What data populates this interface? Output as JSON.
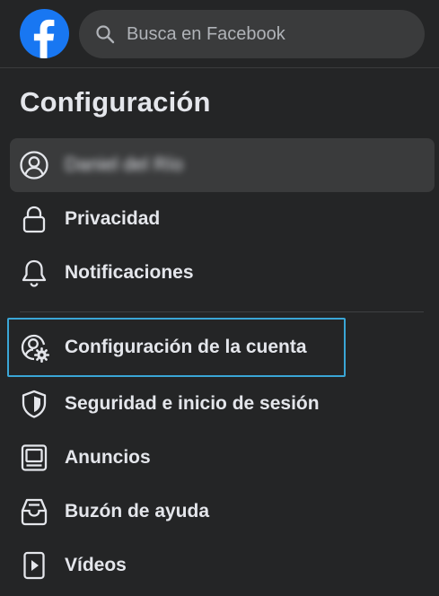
{
  "search": {
    "placeholder": "Busca en Facebook"
  },
  "page_title": "Configuración",
  "menu": {
    "profile": {
      "label": "Daniel del Río",
      "icon": "user-circle-icon"
    },
    "items": [
      {
        "label": "Privacidad",
        "icon": "lock-icon"
      },
      {
        "label": "Notificaciones",
        "icon": "bell-icon"
      },
      {
        "label": "Configuración de la cuenta",
        "icon": "user-gear-icon"
      },
      {
        "label": "Seguridad e inicio de sesión",
        "icon": "shield-icon"
      },
      {
        "label": "Anuncios",
        "icon": "monitor-icon"
      },
      {
        "label": "Buzón de ayuda",
        "icon": "inbox-icon"
      },
      {
        "label": "Vídeos",
        "icon": "video-icon"
      }
    ]
  },
  "colors": {
    "background": "#242526",
    "brand": "#1877f2",
    "search_bg": "#3a3b3c",
    "highlight_border": "#3aa6d6",
    "text": "#e4e6eb"
  }
}
